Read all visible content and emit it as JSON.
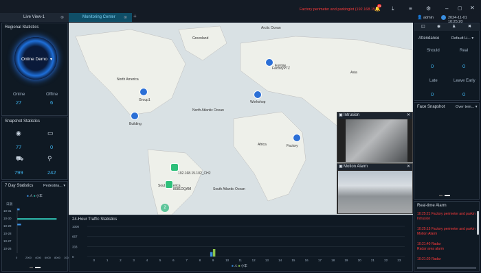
{
  "tabs": [
    {
      "label": "Live View-1"
    },
    {
      "label": "Monitoring Center"
    }
  ],
  "topbar": {
    "alert": "Factory perimeter and parkinglot (192.168.15.100)",
    "alert_count": "99",
    "user": "admin",
    "datetime": "2024-11-01 10:25:20"
  },
  "regional": {
    "title": "Regional Statistics",
    "demo": "Online Demo",
    "online_label": "Online",
    "offline_label": "Offline",
    "online": "27",
    "offline": "6"
  },
  "snapshot": {
    "title": "Snapshot Statistics",
    "values": [
      "77",
      "0",
      "799",
      "242"
    ]
  },
  "seven_day": {
    "title": "7 Day Statistics",
    "filter": "Pedestria...",
    "legend": [
      "人",
      "小车"
    ],
    "ylabel": "日期",
    "dates": [
      "10-31",
      "10-30",
      "10-29",
      "10-28",
      "10-27",
      "10-26"
    ],
    "xticks": [
      "0",
      "2000",
      "4000",
      "6000",
      "8000",
      "100..."
    ]
  },
  "traffic": {
    "title": "24-Hour Traffic Statistics",
    "yticks": [
      "1000",
      "667",
      "333",
      "0"
    ],
    "hours": [
      "0",
      "1",
      "2",
      "3",
      "4",
      "5",
      "6",
      "7",
      "8",
      "9",
      "10",
      "11",
      "12",
      "13",
      "14",
      "15",
      "16",
      "17",
      "18",
      "19",
      "20",
      "21",
      "22",
      "23"
    ],
    "legend": [
      "人",
      "小车"
    ]
  },
  "map": {
    "regions": [
      "Greenland",
      "North America",
      "South America",
      "Europe",
      "Africa",
      "Asia",
      "Arctic Ocean",
      "North Atlantic Ocean",
      "South Atlantic Ocean"
    ],
    "markers": [
      {
        "label": "FactoryPTZ"
      },
      {
        "label": "Workshop"
      },
      {
        "label": "Group1"
      },
      {
        "label": "Building"
      },
      {
        "label": "Factory"
      },
      {
        "label": "192.168.15.102_CH2"
      },
      {
        "label": "8081DQAM"
      },
      {
        "label": "2"
      }
    ]
  },
  "cameras": [
    {
      "title": "Intrusion"
    },
    {
      "title": "Motion Alarm"
    }
  ],
  "attendance": {
    "tab": "Attendance",
    "filter": "Default Li...",
    "should_label": "Should",
    "real_label": "Real",
    "late_label": "Late",
    "early_label": "Leave Early",
    "should": "0",
    "real": "0",
    "late": "0",
    "early": "0"
  },
  "face": {
    "title": "Face Snapshot",
    "filter": "Over tem..."
  },
  "alarms": {
    "title": "Real-time Alarm",
    "items": [
      {
        "time": "10:25:21",
        "text": "Factory perimeter and parkin",
        "sub": "Intrusion"
      },
      {
        "time": "10:25:15",
        "text": "Factory perimeter and parkin",
        "sub": "Motion Alarm"
      },
      {
        "time": "10:21:40",
        "text": "Radar",
        "sub": "Radar area alarm"
      },
      {
        "time": "10:21:20",
        "text": "Radar",
        "sub": ""
      }
    ]
  },
  "chart_data": [
    {
      "type": "bar",
      "title": "7 Day Statistics",
      "categories": [
        "10-31",
        "10-30",
        "10-29",
        "10-28",
        "10-27",
        "10-26"
      ],
      "series": [
        {
          "name": "人",
          "values": [
            500,
            0,
            800,
            0,
            0,
            0
          ]
        },
        {
          "name": "小车",
          "values": [
            0,
            8200,
            0,
            0,
            0,
            0
          ]
        }
      ],
      "xlim": [
        0,
        10000
      ]
    },
    {
      "type": "bar",
      "title": "24-Hour Traffic Statistics",
      "categories": [
        "0",
        "1",
        "2",
        "3",
        "4",
        "5",
        "6",
        "7",
        "8",
        "9",
        "10",
        "11",
        "12",
        "13",
        "14",
        "15",
        "16",
        "17",
        "18",
        "19",
        "20",
        "21",
        "22",
        "23"
      ],
      "series": [
        {
          "name": "人",
          "values": [
            0,
            0,
            0,
            0,
            0,
            0,
            0,
            0,
            0,
            150,
            0,
            0,
            0,
            0,
            0,
            0,
            0,
            0,
            0,
            0,
            0,
            0,
            0,
            0
          ]
        },
        {
          "name": "小车",
          "values": [
            0,
            0,
            0,
            0,
            0,
            0,
            0,
            0,
            0,
            250,
            0,
            0,
            0,
            0,
            0,
            0,
            0,
            0,
            0,
            0,
            0,
            0,
            0,
            0
          ]
        }
      ],
      "ylim": [
        0,
        1000
      ]
    }
  ]
}
